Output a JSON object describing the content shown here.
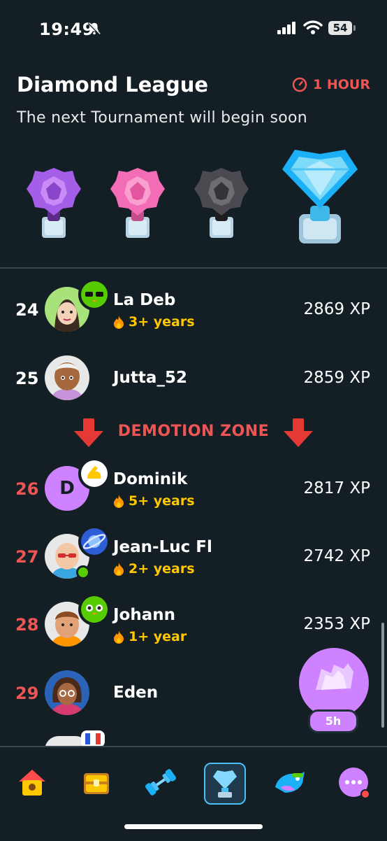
{
  "status_bar": {
    "time": "19:49",
    "battery": "54"
  },
  "header": {
    "title": "Diamond League",
    "timer": "1 HOUR",
    "subtitle": "The next Tournament will begin soon"
  },
  "trophies": [
    "amethyst-trophy-icon",
    "pearl-trophy-icon",
    "obsidian-trophy-icon",
    "diamond-trophy-icon"
  ],
  "leaderboard": [
    {
      "rank": "24",
      "name": "La Deb",
      "streak": "3+ years",
      "xp": "2869 XP",
      "zone": "normal"
    },
    {
      "rank": "25",
      "name": "Jutta_52",
      "streak": "",
      "xp": "2859 XP",
      "zone": "normal"
    },
    {
      "rank": "26",
      "name": "Dominik",
      "avatar_letter": "D",
      "streak": "5+ years",
      "xp": "2817 XP",
      "zone": "demotion"
    },
    {
      "rank": "27",
      "name": "Jean-Luc Fl",
      "streak": "2+ years",
      "xp": "2742 XP",
      "zone": "demotion"
    },
    {
      "rank": "28",
      "name": "Johann",
      "streak": "1+ year",
      "xp": "2353 XP",
      "zone": "demotion"
    },
    {
      "rank": "29",
      "name": "Eden",
      "streak": "",
      "xp": "",
      "zone": "demotion"
    }
  ],
  "demotion_zone": {
    "label": "DEMOTION ZONE"
  },
  "chest": {
    "timer": "5h"
  },
  "tabs": [
    {
      "name": "home",
      "icon": "house-icon"
    },
    {
      "name": "quests",
      "icon": "chest-icon"
    },
    {
      "name": "practice",
      "icon": "dumbbell-icon"
    },
    {
      "name": "leagues",
      "icon": "trophy-icon",
      "active": true
    },
    {
      "name": "super",
      "icon": "bird-icon"
    },
    {
      "name": "more",
      "icon": "more-icon"
    }
  ],
  "colors": {
    "background": "#131f24",
    "danger": "#ee5555",
    "streak": "#ffc800",
    "active_tab": "#49c0f8",
    "chest": "#ce82ff"
  }
}
